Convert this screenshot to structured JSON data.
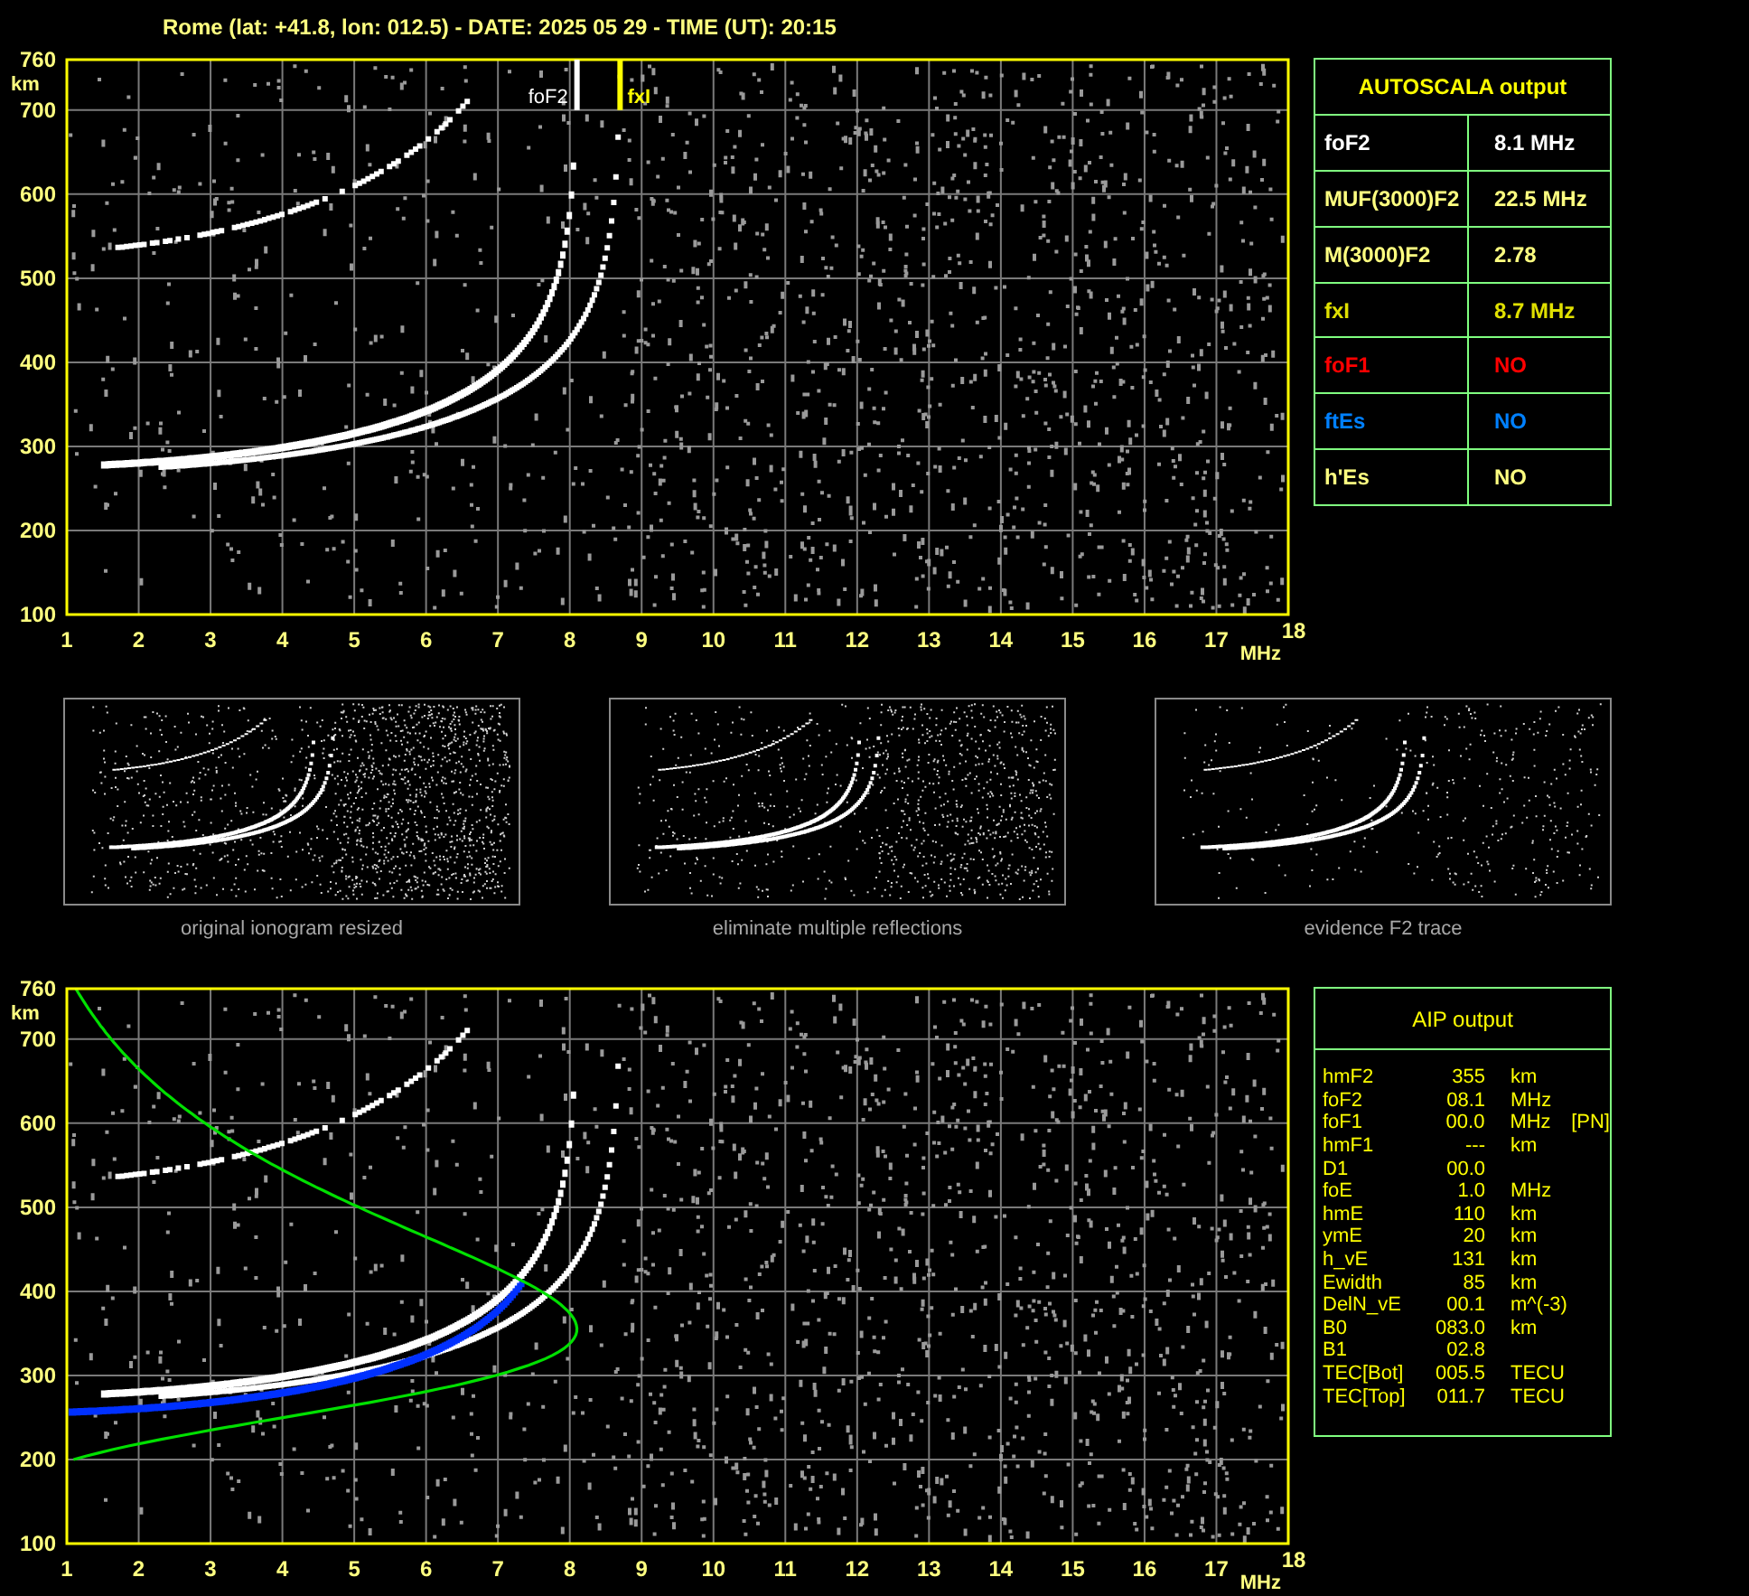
{
  "header": "Rome (lat: +41.8, lon: 012.5) - DATE: 2025 05 29 - TIME (UT): 20:15",
  "ionogram": {
    "y_ticks": [
      "760",
      "700",
      "600",
      "500",
      "400",
      "300",
      "200",
      "100"
    ],
    "y_unit": "km",
    "x_ticks": [
      "1",
      "2",
      "3",
      "4",
      "5",
      "6",
      "7",
      "8",
      "9",
      "10",
      "11",
      "12",
      "13",
      "14",
      "15",
      "16",
      "17",
      "18"
    ],
    "x_unit": "MHz",
    "markers": [
      {
        "label": "foF2",
        "color": "#ffffff"
      },
      {
        "label": "fxI",
        "color": "#ffff00"
      }
    ]
  },
  "autoscala": {
    "title": "AUTOSCALA output",
    "rows": [
      {
        "name": "foF2",
        "value": "8.1 MHz",
        "color": "#ffffff"
      },
      {
        "name": "MUF(3000)F2",
        "value": "22.5 MHz",
        "color": "#ffff80"
      },
      {
        "name": "M(3000)F2",
        "value": "2.78",
        "color": "#ffff80"
      },
      {
        "name": "fxI",
        "value": "8.7 MHz",
        "color": "#e0e000"
      },
      {
        "name": "foF1",
        "value": "NO",
        "color": "#ff0000"
      },
      {
        "name": "ftEs",
        "value": "NO",
        "color": "#0080ff"
      },
      {
        "name": "h'Es",
        "value": "NO",
        "color": "#ffff80"
      }
    ]
  },
  "thumbnails": [
    {
      "caption": "original ionogram resized",
      "kind": "original"
    },
    {
      "caption": "eliminate multiple reflections",
      "kind": "no_multiple"
    },
    {
      "caption": "evidence F2 trace",
      "kind": "f2_only"
    }
  ],
  "profile_ionogram": {
    "y_ticks": [
      "760",
      "700",
      "600",
      "500",
      "400",
      "300",
      "200",
      "100"
    ],
    "y_unit": "km",
    "x_ticks": [
      "1",
      "2",
      "3",
      "4",
      "5",
      "6",
      "7",
      "8",
      "9",
      "10",
      "11",
      "12",
      "13",
      "14",
      "15",
      "16",
      "17",
      "18"
    ],
    "x_unit": "MHz"
  },
  "aip": {
    "title": "AIP output",
    "rows": [
      {
        "name": "hmF2",
        "value": "355",
        "unit": "km"
      },
      {
        "name": "foF2",
        "value": "08.1",
        "unit": "MHz"
      },
      {
        "name": "foF1",
        "value": "00.0",
        "unit": "MHz",
        "flag": "[PN]"
      },
      {
        "name": "hmF1",
        "value": "---",
        "unit": "km"
      },
      {
        "name": "D1",
        "value": "00.0"
      },
      {
        "name": "foE",
        "value": "1.0",
        "unit": "MHz"
      },
      {
        "name": "hmE",
        "value": "110",
        "unit": "km"
      },
      {
        "name": "ymE",
        "value": "20",
        "unit": "km"
      },
      {
        "name": "h_vE",
        "value": "131",
        "unit": "km"
      },
      {
        "name": "Ewidth",
        "value": "85",
        "unit": "km"
      },
      {
        "name": "DelN_vE",
        "value": "00.1",
        "unit": "m^(-3)"
      },
      {
        "name": "B0",
        "value": "083.0",
        "unit": "km"
      },
      {
        "name": "B1",
        "value": "02.8"
      },
      {
        "name": "TEC[Bot]",
        "value": "005.5",
        "unit": "TECU"
      },
      {
        "name": "TEC[Top]",
        "value": "011.7",
        "unit": "TECU"
      }
    ]
  }
}
